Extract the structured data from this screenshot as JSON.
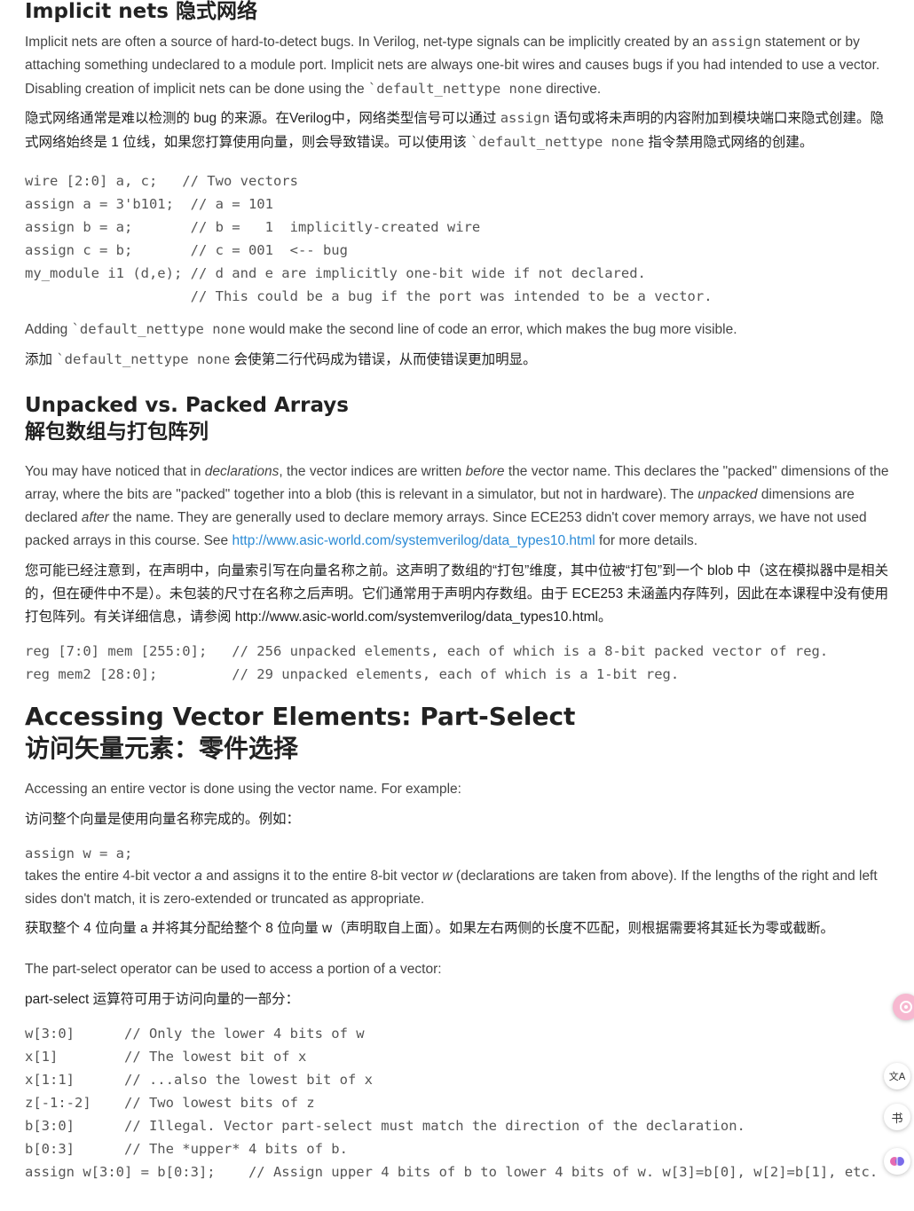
{
  "s1": {
    "title": "Implicit nets 隐式网络",
    "p1a": "Implicit nets are often a source of hard-to-detect bugs. In Verilog, net-type signals can be implicitly created by an ",
    "p1code": "assign",
    "p1b": " statement or by attaching something undeclared to a module port. Implicit nets are always one-bit wires and causes bugs if you had intended to use a vector. Disabling creation of implicit nets can be done using the ",
    "p1code2": "`default_nettype none",
    "p1c": " directive.",
    "p2a": "隐式网络通常是难以检测的 bug 的来源。在Verilog中，网络类型信号可以通过 ",
    "p2code": "assign",
    "p2b": " 语句或将未声明的内容附加到模块端口来隐式创建。隐式网络始终是 1 位线，如果您打算使用向量，则会导致错误。可以使用该 ",
    "p2code2": "`default_nettype none",
    "p2c": " 指令禁用隐式网络的创建。",
    "code": "wire [2:0] a, c;   // Two vectors\nassign a = 3'b101;  // a = 101\nassign b = a;       // b =   1  implicitly-created wire\nassign c = b;       // c = 001  <-- bug\nmy_module i1 (d,e); // d and e are implicitly one-bit wide if not declared.\n                    // This could be a bug if the port was intended to be a vector.",
    "p3a": "Adding ",
    "p3code": "`default_nettype none",
    "p3b": " would make the second line of code an error, which makes the bug more visible.",
    "p4a": "添加 ",
    "p4code": "`default_nettype none",
    "p4b": " 会使第二行代码成为错误，从而使错误更加明显。"
  },
  "s2": {
    "title_en": "Unpacked vs. Packed Arrays",
    "title_zh": "解包数组与打包阵列",
    "p1a": "You may have noticed that in ",
    "p1em1": "declarations",
    "p1b": ", the vector indices are written ",
    "p1em2": "before",
    "p1c": " the vector name. This declares the \"packed\" dimensions of the array, where the bits are \"packed\" together into a blob (this is relevant in a simulator, but not in hardware). The ",
    "p1em3": "unpacked",
    "p1d": " dimensions are declared ",
    "p1em4": "after",
    "p1e": " the name. They are generally used to declare memory arrays. Since ECE253 didn't cover memory arrays, we have not used packed arrays in this course. See ",
    "p1link": "http://www.asic-world.com/systemverilog/data_types10.html",
    "p1f": " for more details.",
    "p2": "您可能已经注意到，在声明中，向量索引写在向量名称之前。这声明了数组的“打包”维度，其中位被“打包”到一个 blob 中（这在模拟器中是相关的，但在硬件中不是）。未包装的尺寸在名称之后声明。它们通常用于声明内存数组。由于 ECE253 未涵盖内存阵列，因此在本课程中没有使用打包阵列。有关详细信息，请参阅 http://www.asic-world.com/systemverilog/data_types10.html。",
    "code": "reg [7:0] mem [255:0];   // 256 unpacked elements, each of which is a 8-bit packed vector of reg.\nreg mem2 [28:0];         // 29 unpacked elements, each of which is a 1-bit reg."
  },
  "s3": {
    "title_en": "Accessing Vector Elements: Part-Select",
    "title_zh": "访问矢量元素：零件选择",
    "p1": "Accessing an entire vector is done using the vector name. For example:",
    "p2": "访问整个向量是使用向量名称完成的。例如：",
    "code1": "assign w = a;",
    "p3a": "takes the entire 4-bit vector ",
    "p3em1": "a",
    "p3b": " and assigns it to the entire 8-bit vector ",
    "p3em2": "w",
    "p3c": " (declarations are taken from above). If the lengths of the right and left sides don't match, it is zero-extended or truncated as appropriate.",
    "p4": "获取整个 4 位向量 a 并将其分配给整个 8 位向量 w（声明取自上面）。如果左右两侧的长度不匹配，则根据需要将其延长为零或截断。",
    "p5": "The part-select operator can be used to access a portion of a vector:",
    "p6": "part-select 运算符可用于访问向量的一部分：",
    "code2": "w[3:0]      // Only the lower 4 bits of w\nx[1]        // The lowest bit of x\nx[1:1]      // ...also the lowest bit of x\nz[-1:-2]    // Two lowest bits of z\nb[3:0]      // Illegal. Vector part-select must match the direction of the declaration.\nb[0:3]      // The *upper* 4 bits of b.\nassign w[3:0] = b[0:3];    // Assign upper 4 bits of b to lower 4 bits of w. w[3]=b[0], w[2]=b[1], etc."
  },
  "floating": {
    "icons": [
      "assistant-icon",
      "translate-icon",
      "book-icon",
      "brain-icon"
    ],
    "translate_glyph": "文A",
    "book_glyph": "书"
  }
}
